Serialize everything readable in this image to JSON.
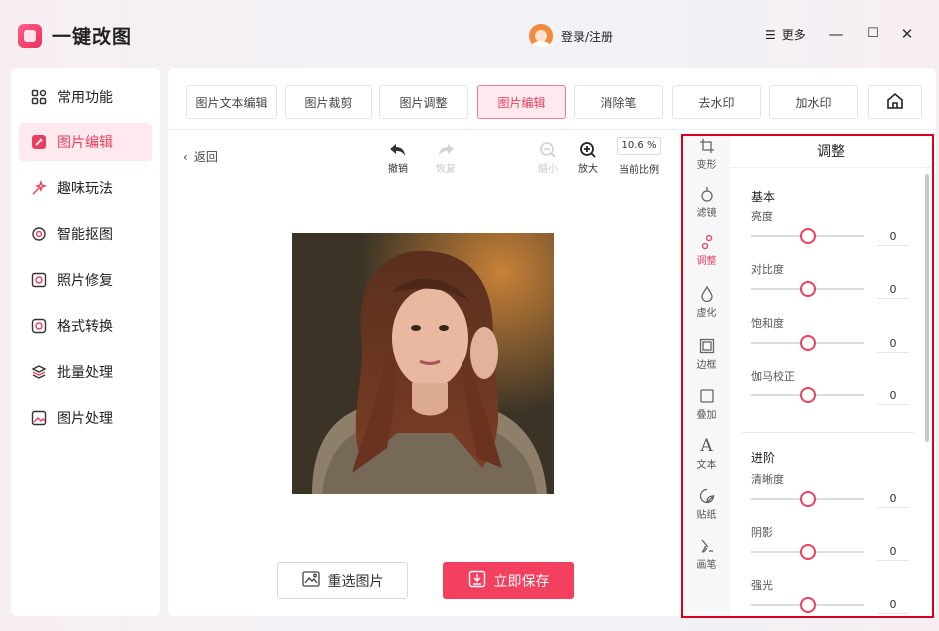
{
  "app": {
    "title": "一键改图",
    "login": "登录/注册",
    "more": "更多"
  },
  "window_controls": {
    "minimize": "—",
    "maximize": "☐",
    "close": "✕"
  },
  "sidebar": {
    "items": [
      {
        "label": "常用功能",
        "icon": "grid-icon",
        "active": false
      },
      {
        "label": "图片编辑",
        "icon": "edit-icon",
        "active": true
      },
      {
        "label": "趣味玩法",
        "icon": "magic-icon",
        "active": false
      },
      {
        "label": "智能抠图",
        "icon": "target-icon",
        "active": false
      },
      {
        "label": "照片修复",
        "icon": "restore-icon",
        "active": false
      },
      {
        "label": "格式转换",
        "icon": "convert-icon",
        "active": false
      },
      {
        "label": "批量处理",
        "icon": "layers-icon",
        "active": false
      },
      {
        "label": "图片处理",
        "icon": "image-icon",
        "active": false
      }
    ]
  },
  "tabs": [
    {
      "label": "图片文本编辑",
      "active": false
    },
    {
      "label": "图片裁剪",
      "active": false
    },
    {
      "label": "图片调整",
      "active": false
    },
    {
      "label": "图片编辑",
      "active": true
    },
    {
      "label": "消除笔",
      "active": false
    },
    {
      "label": "去水印",
      "active": false
    },
    {
      "label": "加水印",
      "active": false
    }
  ],
  "toolbar": {
    "back": "返回",
    "undo": "撤销",
    "redo": "恢复",
    "zoom_out": "缩小",
    "zoom_in": "放大",
    "zoom_value": "10.6 %",
    "zoom_label": "当前比例"
  },
  "actions": {
    "reselect": "重选图片",
    "save": "立即保存"
  },
  "adjust_panel": {
    "title": "调整",
    "rail": [
      {
        "label": "变形",
        "icon": "transform-icon",
        "active": false
      },
      {
        "label": "滤镜",
        "icon": "filter-icon",
        "active": false
      },
      {
        "label": "调整",
        "icon": "adjust-icon",
        "active": true
      },
      {
        "label": "虚化",
        "icon": "blur-drop-icon",
        "active": false
      },
      {
        "label": "边框",
        "icon": "border-icon",
        "active": false
      },
      {
        "label": "叠加",
        "icon": "overlay-icon",
        "active": false
      },
      {
        "label": "文本",
        "icon": "text-icon",
        "active": false
      },
      {
        "label": "贴纸",
        "icon": "sticker-icon",
        "active": false
      },
      {
        "label": "画笔",
        "icon": "brush-icon",
        "active": false
      }
    ],
    "basic": {
      "title": "基本",
      "sliders": [
        {
          "label": "亮度",
          "value": "0",
          "level": 0.5
        },
        {
          "label": "对比度",
          "value": "0",
          "level": 0.5
        },
        {
          "label": "饱和度",
          "value": "0",
          "level": 0.5
        },
        {
          "label": "伽马校正",
          "value": "0",
          "level": 0.5
        }
      ]
    },
    "advanced": {
      "title": "进阶",
      "sliders": [
        {
          "label": "清晰度",
          "value": "0",
          "level": 0.5
        },
        {
          "label": "阴影",
          "value": "0",
          "level": 0.5
        },
        {
          "label": "强光",
          "value": "0",
          "level": 0.5
        }
      ]
    }
  },
  "colors": {
    "accent": "#e8405f",
    "highlight_border": "#d9001b",
    "save_button": "#f2405e"
  }
}
